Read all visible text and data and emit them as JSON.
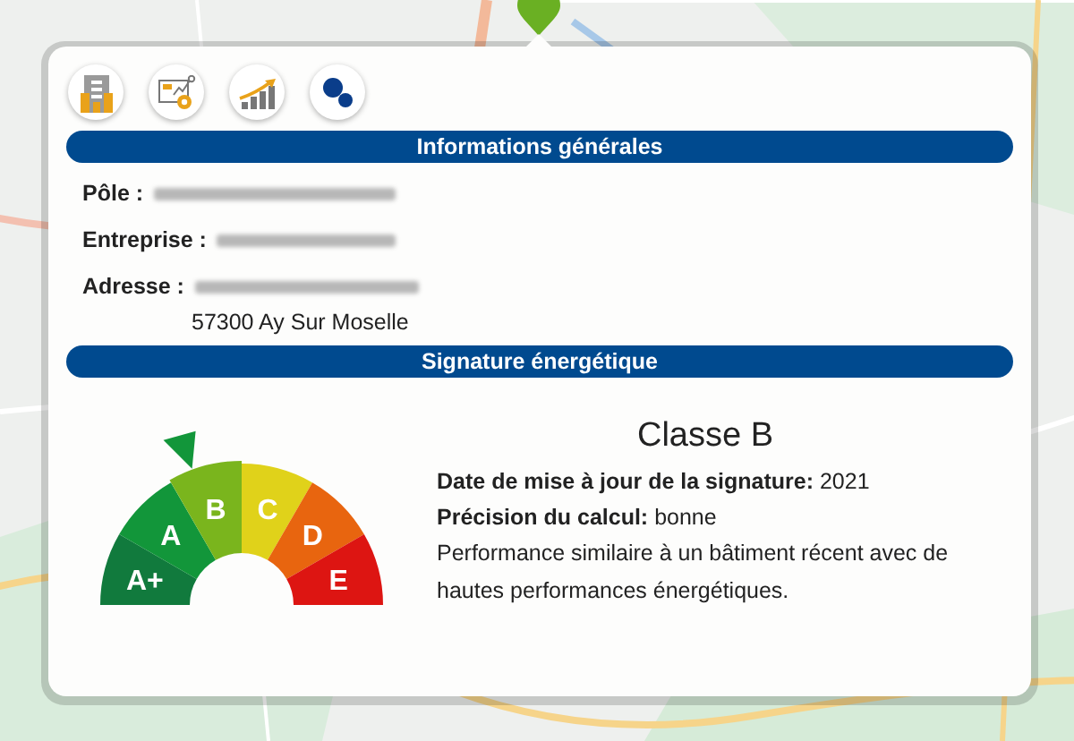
{
  "icon_buttons": [
    {
      "kind": "building"
    },
    {
      "kind": "dashboard"
    },
    {
      "kind": "growth"
    },
    {
      "kind": "bubbles"
    }
  ],
  "general": {
    "title": "Informations générales",
    "fields": [
      {
        "label": "Pôle :"
      },
      {
        "label": "Entreprise :"
      },
      {
        "label": "Adresse :",
        "extra_line": "57300 Ay Sur Moselle"
      }
    ]
  },
  "signature": {
    "title": "Signature énergétique",
    "classes": [
      {
        "label": "A+",
        "color": "#117a3d",
        "selected": false
      },
      {
        "label": "A",
        "color": "#12963a",
        "selected": false
      },
      {
        "label": "B",
        "color": "#7ab51d",
        "selected": true
      },
      {
        "label": "C",
        "color": "#e0d21a",
        "selected": false
      },
      {
        "label": "D",
        "color": "#e8650f",
        "selected": false
      },
      {
        "label": "E",
        "color": "#dd1512",
        "selected": false
      }
    ],
    "class_title": "Classe B",
    "details": [
      {
        "label": "Date de mise à jour de la signature:",
        "value": "2021"
      },
      {
        "label": "Précision du calcul:",
        "value": "bonne"
      }
    ],
    "description": "Performance similaire à un bâtiment récent avec de hautes performances énergétiques."
  }
}
